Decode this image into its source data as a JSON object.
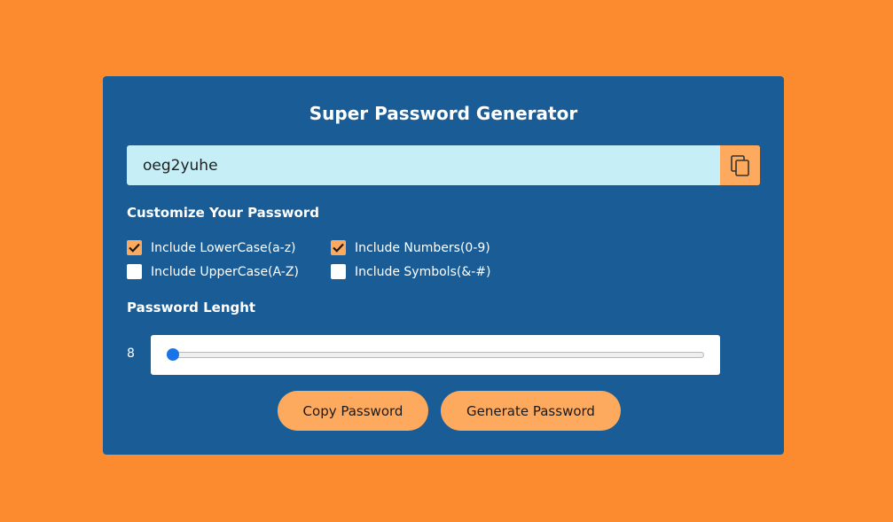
{
  "colors": {
    "page_background": "#fc8a2e",
    "card_background": "#1a5d96",
    "password_field_background": "#c6eef6",
    "accent": "#fdaa5f",
    "slider_thumb": "#1a73e8"
  },
  "app": {
    "title": "Super Password Generator"
  },
  "password": {
    "value": "oeg2yuhe",
    "copy_icon": "copy-icon"
  },
  "customize": {
    "heading": "Customize Your Password",
    "options": [
      {
        "label": "Include LowerCase(a-z)",
        "checked": true
      },
      {
        "label": "Include Numbers(0-9)",
        "checked": true
      },
      {
        "label": "Include UpperCase(A-Z)",
        "checked": false
      },
      {
        "label": "Include Symbols(&-#)",
        "checked": false
      }
    ]
  },
  "length": {
    "heading": "Password Lenght",
    "value": "8",
    "slider_fraction": 0
  },
  "buttons": {
    "copy": "Copy Password",
    "generate": "Generate Password"
  }
}
